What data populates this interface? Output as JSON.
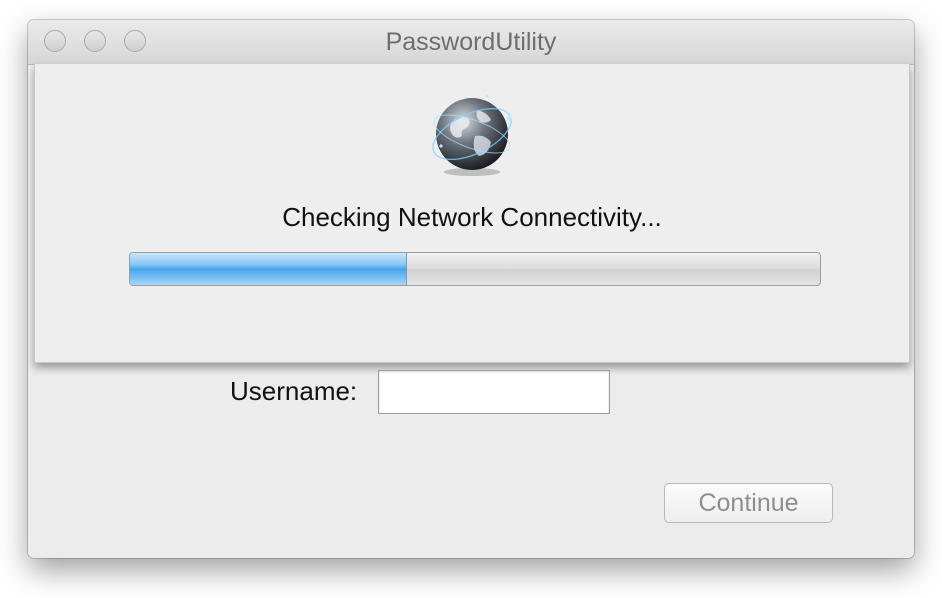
{
  "window": {
    "title": "PasswordUtility"
  },
  "sheet": {
    "icon": "globe-network-icon",
    "status_text": "Checking Network Connectivity...",
    "progress_fraction": 0.4
  },
  "form": {
    "username_label": "Username:",
    "username_value": "",
    "continue_label": "Continue"
  },
  "colors": {
    "progress_accent": "#4aa5ec",
    "disabled_text": "#8e8e8e"
  }
}
